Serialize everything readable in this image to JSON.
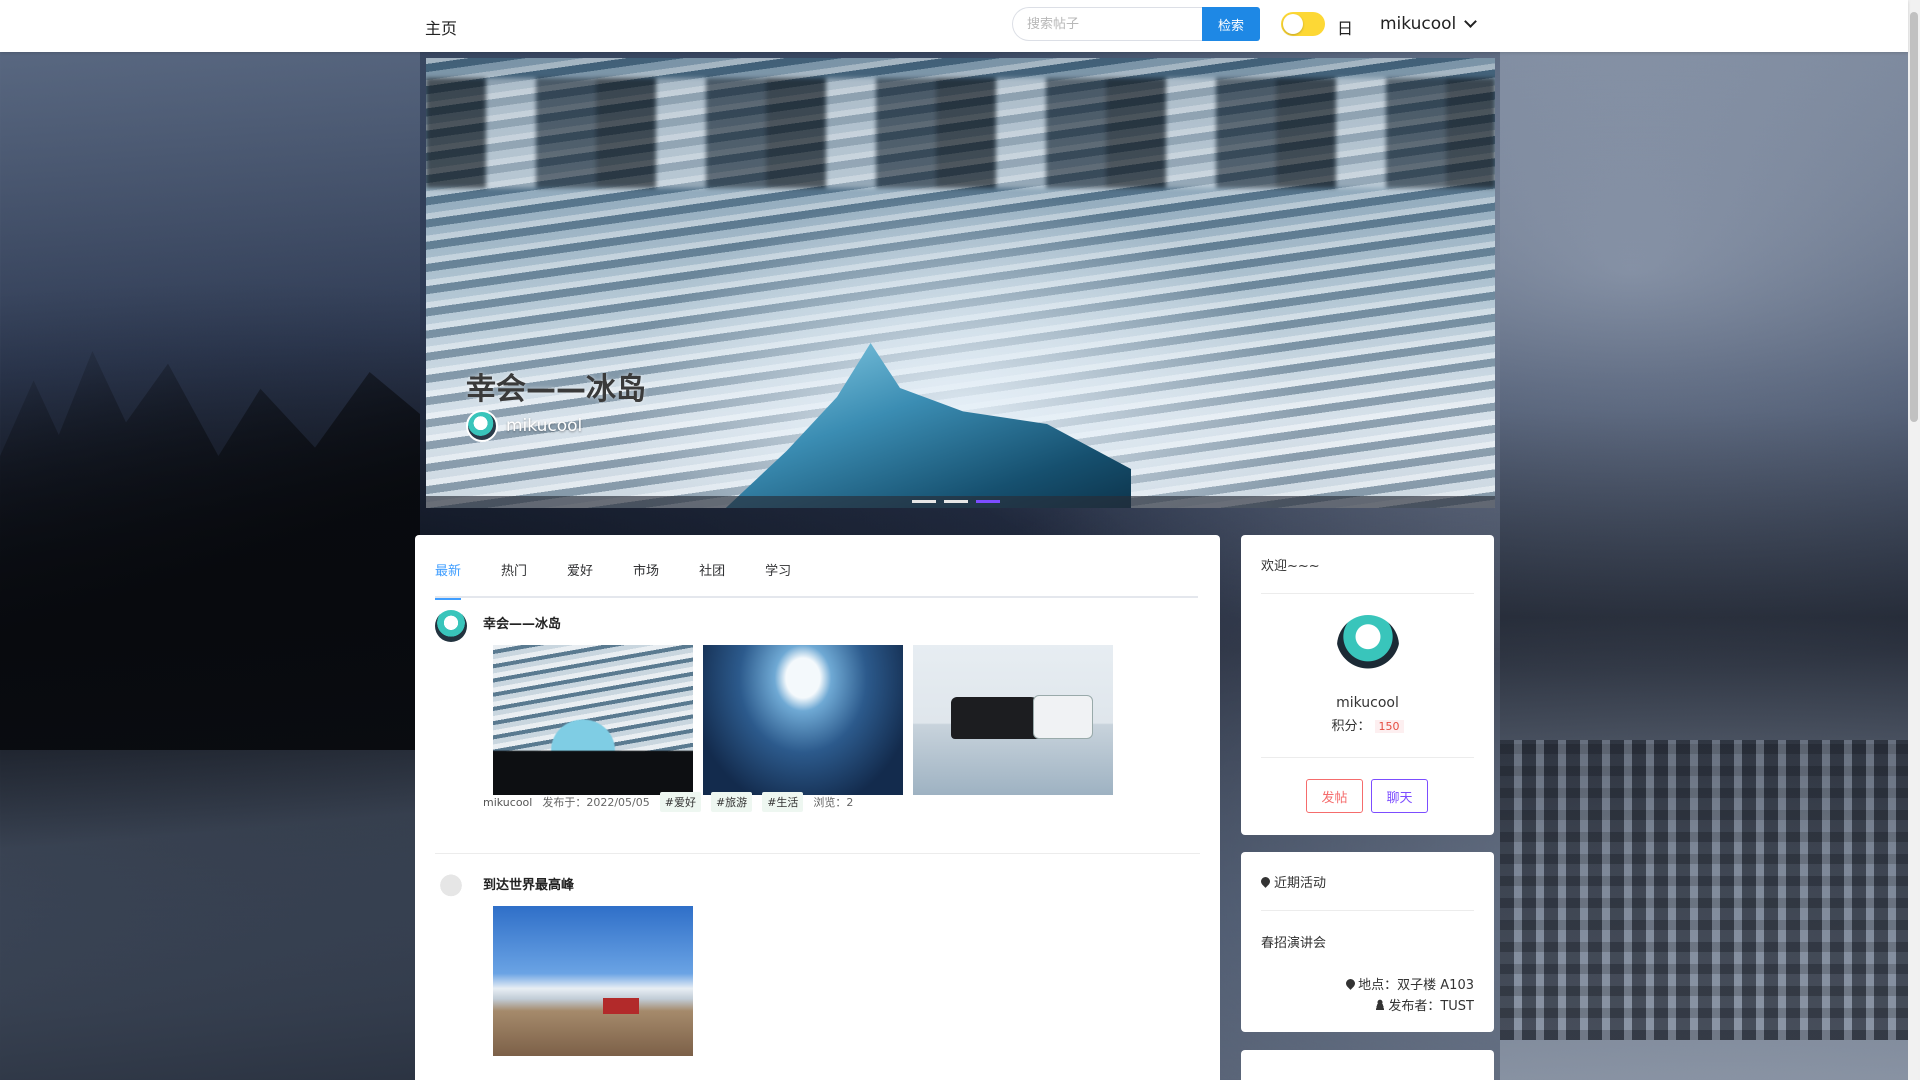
{
  "nav": {
    "home": "主页",
    "search_placeholder": "搜索帖子",
    "search_button": "检索",
    "theme_label": "日",
    "username": "mikucool"
  },
  "banner": {
    "title": "幸会——冰岛",
    "author": "mikucool",
    "slides": 3,
    "active_slide": 3
  },
  "tabs": [
    "最新",
    "热门",
    "爱好",
    "市场",
    "社团",
    "学习"
  ],
  "active_tab": "最新",
  "posts": [
    {
      "title": "幸会——冰岛",
      "images": [
        "ice-on-beach-photo",
        "ice-cave-photo",
        "vans-on-ice-photo"
      ],
      "author": "mikucool",
      "published": "发布于：2022/05/05",
      "tags": [
        "#爱好",
        "#旅游",
        "#生活"
      ],
      "views": "浏览：2"
    },
    {
      "title": "到达世界最高峰",
      "images": [
        "mountain-landscape-photo"
      ]
    }
  ],
  "welcome": {
    "heading": "欢迎~~~",
    "name": "mikucool",
    "points_label": "积分：",
    "points_value": "150",
    "post_button": "发帖",
    "chat_button": "聊天"
  },
  "activity": {
    "heading": "近期活动",
    "title": "春招演讲会",
    "location": "地点：双子楼 A103",
    "publisher": "发布者：TUST"
  },
  "colors": {
    "primary": "#409eff",
    "search_button": "#1e88e5",
    "toggle": "#fdd835",
    "post_button": "#f56c6c",
    "chat_button": "#7c4dff",
    "active_dot": "#7c4dff"
  }
}
